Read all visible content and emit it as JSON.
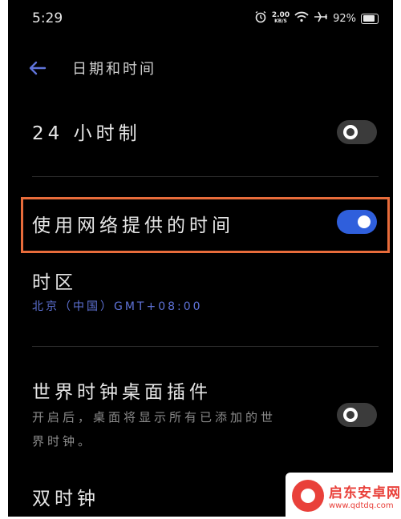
{
  "status_bar": {
    "time": "5:29",
    "net_speed_value": "2.00",
    "net_speed_unit": "KB/S",
    "battery": "92%",
    "icons": [
      "alarm-icon",
      "wifi-icon",
      "airplane-icon",
      "battery-icon"
    ]
  },
  "header": {
    "title": "日期和时间",
    "back_icon": "back-arrow-icon"
  },
  "settings": {
    "hour24": {
      "label": "24 小时制",
      "enabled": false
    },
    "network_time": {
      "label": "使用网络提供的时间",
      "enabled": true
    },
    "timezone": {
      "label": "时区",
      "value": "北京（中国）GMT+08:00"
    },
    "world_clock": {
      "label": "世界时钟桌面插件",
      "desc_line1": "开启后，桌面将显示所有已添加的世",
      "desc_line2": "界时钟。",
      "enabled": false
    },
    "dual_clock": {
      "label": "双时钟"
    }
  },
  "watermark": {
    "name": "启东安卓网",
    "url": "www.qdtdq.com"
  },
  "colors": {
    "accent": "#2f5fdc",
    "highlight": "#e86c3b",
    "link": "#5f73d8"
  }
}
